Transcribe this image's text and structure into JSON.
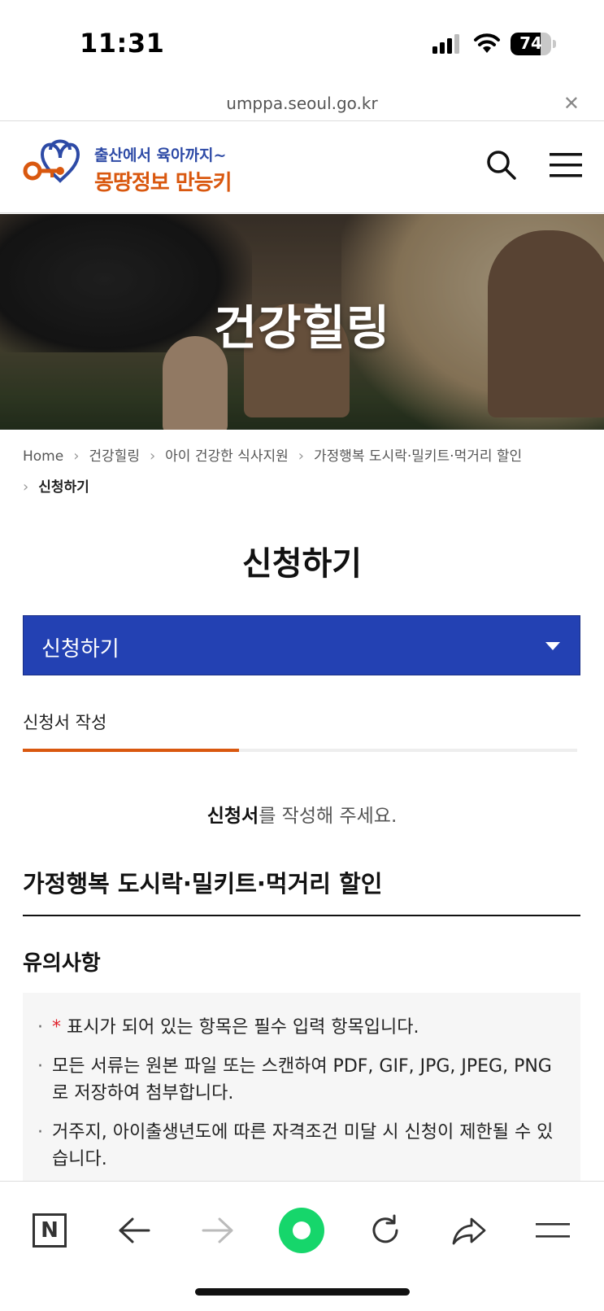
{
  "status_bar": {
    "time": "11:31",
    "battery": "74",
    "battery_level": 0.74,
    "icons": [
      "cellular-signal-icon",
      "wifi-icon",
      "battery-icon"
    ]
  },
  "browser": {
    "url": "umppa.seoul.go.kr",
    "close_icon": "close-icon"
  },
  "header": {
    "logo_line1": "출산에서 육아까지~",
    "logo_line2": "몽땅정보 만능키",
    "search_icon": "search-icon",
    "menu_icon": "hamburger-menu-icon"
  },
  "hero": {
    "title": "건강힐링"
  },
  "breadcrumb": {
    "items": [
      "Home",
      "건강힐링",
      "아이 건강한 식사지원",
      "가정행복 도시락·밀키트·먹거리 할인"
    ],
    "current": "신청하기"
  },
  "page_title": "신청하기",
  "select": {
    "value": "신청하기"
  },
  "step": {
    "label": "신청서 작성",
    "progress": 0.39
  },
  "notice": {
    "bold": "신청서",
    "rest": "를 작성해 주세요."
  },
  "section_title": "가정행복 도시락·밀키트·먹거리 할인",
  "notes": {
    "title": "유의사항",
    "star": "*",
    "items": [
      "표시가 되어 있는 항목은 필수 입력 항목입니다.",
      "모든 서류는 원본 파일 또는 스캔하여 PDF, GIF, JPG, JPEG, PNG로 저장하여 첨부합니다.",
      "거주지, 아이출생년도에 따른 자격조건 미달 시 신청이 제한될 수 있습니다."
    ]
  },
  "toolbar": {
    "n_label": "N",
    "icons": [
      "naver-home-icon",
      "back-arrow-icon",
      "forward-arrow-icon",
      "green-dot-icon",
      "refresh-icon",
      "share-icon",
      "menu-icon"
    ],
    "accent": "#16d66b"
  },
  "colors": {
    "brand_blue": "#2341b3",
    "brand_orange": "#d9580f"
  }
}
